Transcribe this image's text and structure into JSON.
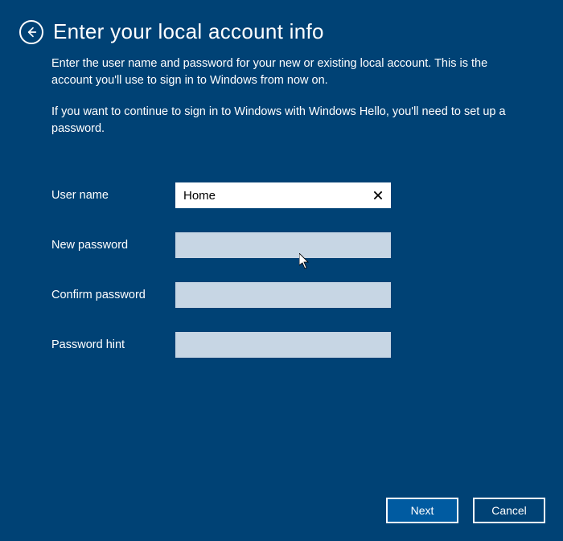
{
  "header": {
    "title": "Enter your local account info"
  },
  "description": {
    "p1": "Enter the user name and password for your new or existing local account. This is the account you'll use to sign in to Windows from now on.",
    "p2": "If you want to continue to sign in to Windows with Windows Hello, you'll need to set up a password."
  },
  "form": {
    "username_label": "User name",
    "username_value": "Home",
    "new_password_label": "New password",
    "new_password_value": "",
    "confirm_password_label": "Confirm password",
    "confirm_password_value": "",
    "hint_label": "Password hint",
    "hint_value": ""
  },
  "footer": {
    "next_label": "Next",
    "cancel_label": "Cancel"
  }
}
